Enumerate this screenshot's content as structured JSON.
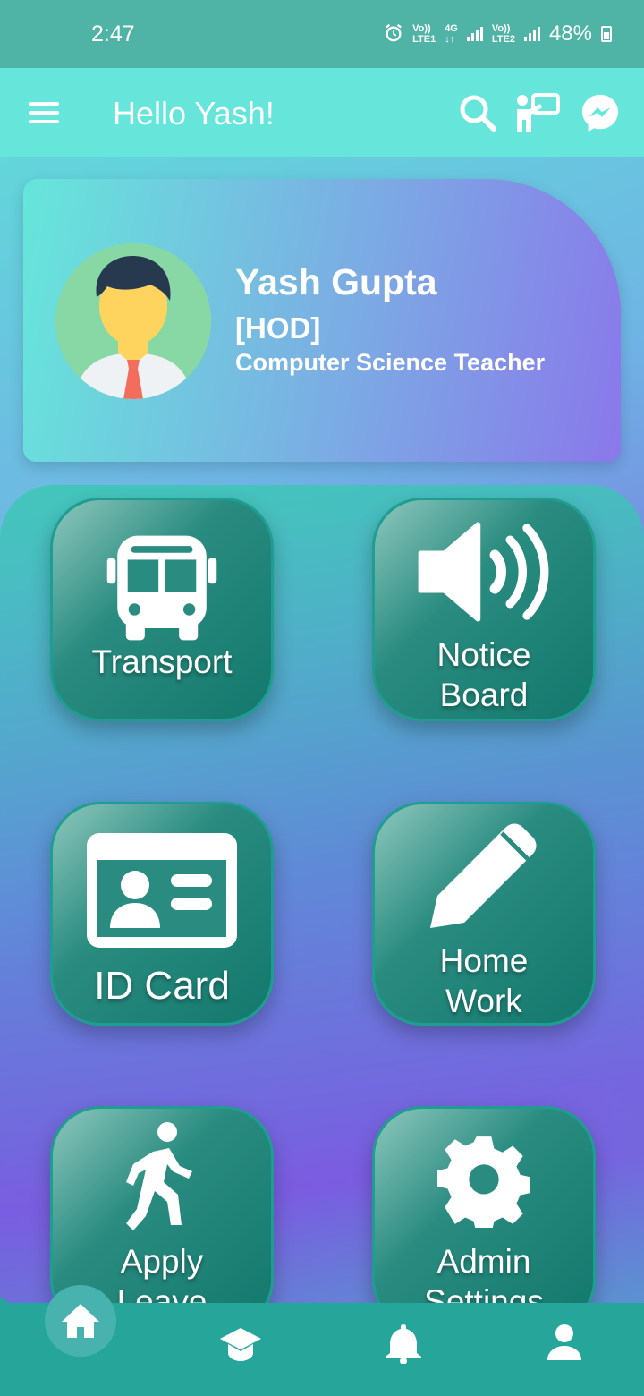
{
  "status_bar": {
    "time": "2:47",
    "sim1_top": "Vo))",
    "sim1_bottom": "LTE1",
    "network_top": "4G",
    "network_bottom": "↓↑",
    "sim2_top": "Vo))",
    "sim2_bottom": "LTE2",
    "battery": "48%"
  },
  "app_bar": {
    "greeting": "Hello Yash!",
    "icons": [
      "search-icon",
      "teacher-board-icon",
      "messenger-icon"
    ]
  },
  "profile": {
    "name": "Yash Gupta",
    "role": "[HOD]",
    "department": "Computer Science Teacher"
  },
  "tiles": [
    {
      "label": "Transport",
      "icon": "bus-icon"
    },
    {
      "label": "Notice Board",
      "icon": "speaker-icon"
    },
    {
      "label": "ID Card",
      "icon": "id-card-icon"
    },
    {
      "label": "Home Work",
      "icon": "pencil-icon"
    },
    {
      "label": "Apply Leave",
      "icon": "walking-icon"
    },
    {
      "label": "Admin Settings",
      "icon": "gear-icon"
    }
  ],
  "tile_labels": {
    "transport": "Transport",
    "notice_1": "Notice",
    "notice_2": "Board",
    "idcard": "ID Card",
    "homework_1": "Home",
    "homework_2": "Work",
    "leave_1": "Apply",
    "leave_2": "Leave",
    "admin_1": "Admin",
    "admin_2": "Settings"
  },
  "bottom_nav": [
    "home-icon",
    "graduation-cap-icon",
    "bell-icon",
    "person-icon"
  ],
  "colors": {
    "status_bar": "#4fb3a6",
    "app_bar": "#66e6da",
    "tile": "#13786d",
    "bottom_nav": "#26a69a"
  }
}
